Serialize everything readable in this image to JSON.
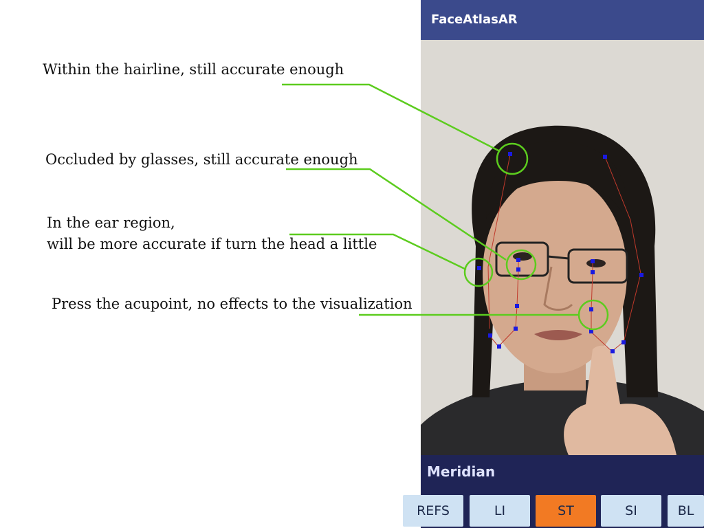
{
  "annotations": [
    "Within the hairline, still accurate enough",
    "Occluded by glasses, still accurate enough",
    "In the ear region,",
    "will be more accurate if turn the head a little",
    "Press the acupoint, no effects to the visualization"
  ],
  "app": {
    "title": "FaceAtlasAR"
  },
  "panel": {
    "title": "Meridian",
    "buttons": [
      "REFS",
      "LI",
      "ST",
      "SI",
      "BL"
    ],
    "selected": "ST"
  },
  "colors": {
    "appbar": "#3b4a8c",
    "panel": "#1f2456",
    "button": "#cfe2f3",
    "button_active": "#f27a23",
    "callout": "#5ccc1e",
    "acupoint": "#1a1ae0",
    "meridian_line": "#c0392b"
  }
}
